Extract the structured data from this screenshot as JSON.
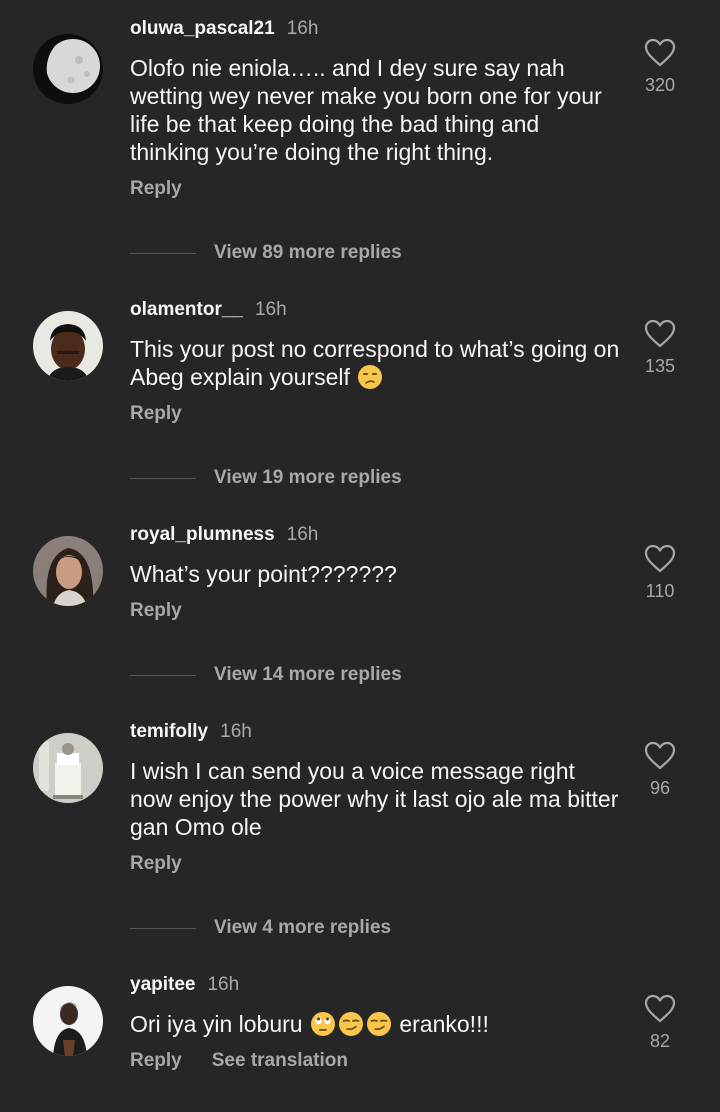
{
  "comments": [
    {
      "username": "oluwa_pascal21",
      "time": "16h",
      "text": "Olofo nie eniola….. and I dey sure say nah wetting wey never make you born one for your life be that keep doing the bad thing and thinking you’re doing the right thing.",
      "likes": "320",
      "reply_label": "Reply",
      "view_replies": "View 89 more replies"
    },
    {
      "username": "olamentor__",
      "time": "16h",
      "text": "This your post no correspond to what’s going on Abeg explain yourself",
      "likes": "135",
      "reply_label": "Reply",
      "view_replies": "View 19 more replies"
    },
    {
      "username": "royal_plumness",
      "time": "16h",
      "text": "What’s your point???????",
      "likes": "110",
      "reply_label": "Reply",
      "view_replies": "View 14 more replies"
    },
    {
      "username": "temifolly",
      "time": "16h",
      "text": "I wish I can send you a voice message right now enjoy the power why it last ojo ale ma bitter gan  Omo ole",
      "likes": "96",
      "reply_label": "Reply",
      "view_replies": "View 4 more replies"
    },
    {
      "username": "yapitee",
      "time": "16h",
      "text_before": "Ori iya yin loburu",
      "text_after": "eranko!!!",
      "likes": "82",
      "reply_label": "Reply",
      "see_translation": "See translation"
    }
  ],
  "icons": {
    "like": "heart-outline-icon",
    "emoji_unamused": "unamused-face-emoji",
    "emoji_eye_roll": "eye-roll-face-emoji",
    "emoji_smirk": "smirking-face-emoji"
  },
  "colors": {
    "background": "#262626",
    "primary_text": "#f5f5f5",
    "secondary_text": "#a8a8a8",
    "emoji_yellow": "#f7c64a"
  }
}
